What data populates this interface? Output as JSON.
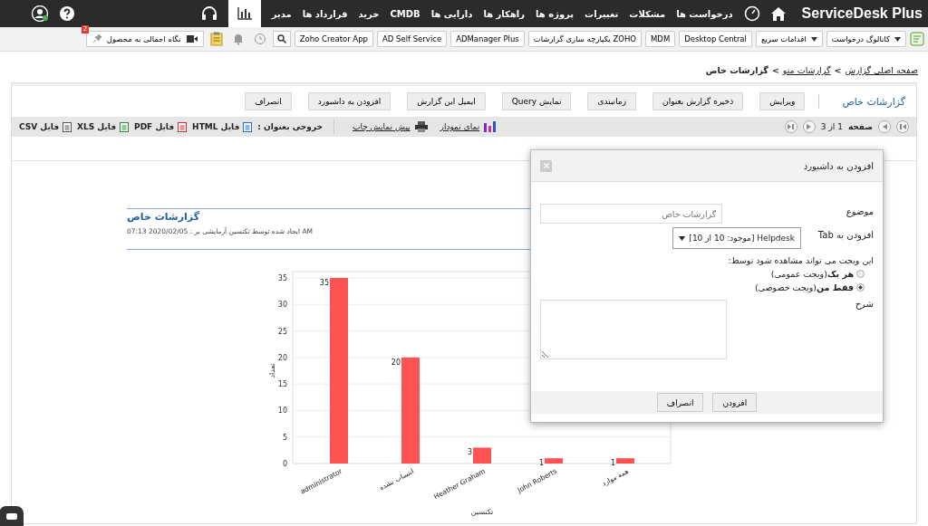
{
  "nav": {
    "logo": "ServiceDesk Plus",
    "items": [
      {
        "label": "درخواست ها",
        "selected": false
      },
      {
        "label": "مشکلات",
        "selected": false
      },
      {
        "label": "تغییرات",
        "selected": false
      },
      {
        "label": "پروژه ها",
        "selected": false
      },
      {
        "label": "راهکار ها",
        "selected": false
      },
      {
        "label": "دارایی ها",
        "selected": false
      },
      {
        "label": "CMDB",
        "selected": false
      },
      {
        "label": "خرید",
        "selected": false
      },
      {
        "label": "قرارداد ها",
        "selected": false
      },
      {
        "label": "مدیر",
        "selected": false
      }
    ],
    "reports_tab": {
      "selected": true
    }
  },
  "toolbar": {
    "dropdowns": [
      "کاتالوگ درخواست",
      "اقدامات سریع"
    ],
    "links": [
      "Desktop Central",
      "MDM",
      "یکپارچه سازی گزارشات ZOHO",
      "ADManager Plus",
      "AD Self Service",
      "Zoho Creator App"
    ],
    "product_tour": "نگاه اجمالی به محصول",
    "badge": "2"
  },
  "breadcrumb": [
    {
      "label": "صفحه اصلی گزارش",
      "kind": "link"
    },
    {
      "label": ">",
      "kind": "sep"
    },
    {
      "label": "گزارشات منو",
      "kind": "link"
    },
    {
      "label": ">",
      "kind": "sep"
    },
    {
      "label": "گزارشات خاص",
      "kind": "current"
    }
  ],
  "report": {
    "title": "گزارشات خاص",
    "actions": [
      "ویرایش",
      "ذخیره گزارش بعنوان",
      "زمانبندی",
      "نمایش Query",
      "ایمیل این گزارش",
      "افزودن به داشبورد",
      "انصراف"
    ],
    "pager": {
      "label": "صفحه",
      "page": "1 از 3"
    },
    "chart_view": "نمای نمودار",
    "print_preview": "پیش نمایش چاپ",
    "export_label": "خروجی بعنوان :",
    "exports": [
      "فایل HTML",
      "فایل PDF",
      "فایل XLS",
      "فایل CSV"
    ],
    "heading": "گزارشات خاص",
    "created": "ایجاد شده توسط تکنسین آزمایشی بر : 2020/02/05 07:13 AM",
    "chart_data": {
      "type": "bar",
      "xlabel": "تکنسین",
      "ylabel": "تعداد",
      "categories": [
        "administrator",
        "انتساب نشده",
        "Heather Graham",
        "John Roberts",
        "همه موارد"
      ],
      "series": [
        {
          "color": "#ff5252",
          "values": [
            35,
            20,
            3,
            1,
            1
          ]
        }
      ],
      "grid": true,
      "ylim": [
        0,
        35
      ],
      "yticks": [
        0,
        5,
        10,
        15,
        20,
        25,
        30,
        35
      ],
      "data_labels": true
    }
  },
  "dialog": {
    "title": "افزودن به داشبورد",
    "subject_label": "موضوع",
    "subject_value": "گزارشات خاص",
    "tab_label": "افزودن به Tab",
    "tab_value": "Helpdesk [موجود: 10 از 10]",
    "visibility_label": "این ویجت می تواند مشاهده شود توسط:",
    "options": [
      {
        "label": "**هر یک**(ویجت عمومی)",
        "selected": false
      },
      {
        "label": "**فقط من**(ویجت خصوصی)",
        "selected": true
      }
    ],
    "description_label": "شرح",
    "buttons": [
      "افزودن",
      "انصراف"
    ]
  }
}
